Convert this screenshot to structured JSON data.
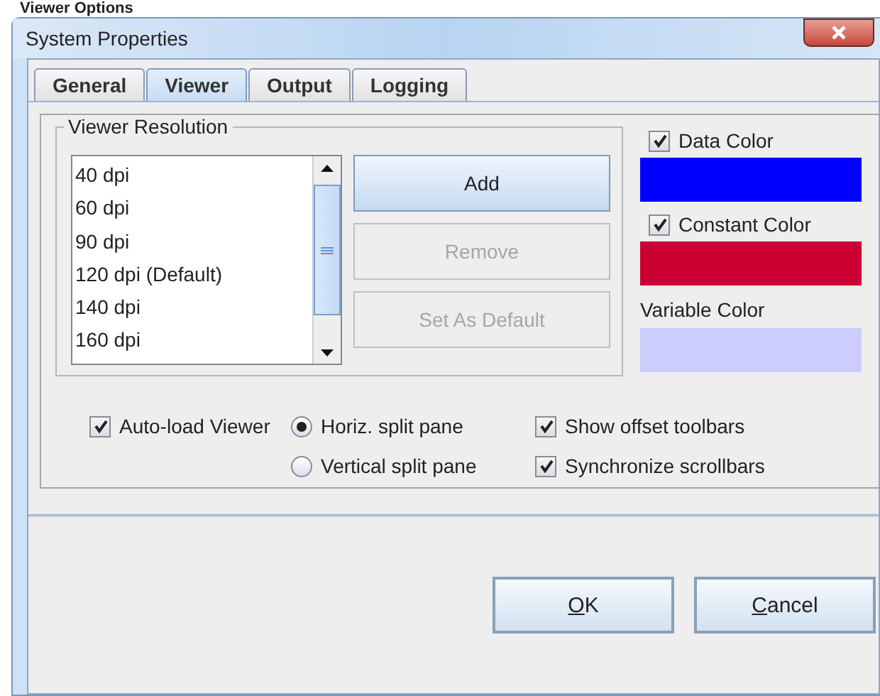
{
  "heading": "Viewer Options",
  "window": {
    "title": "System Properties"
  },
  "tabs": [
    {
      "label": "General",
      "selected": false
    },
    {
      "label": "Viewer",
      "selected": true
    },
    {
      "label": "Output",
      "selected": false
    },
    {
      "label": "Logging",
      "selected": false
    }
  ],
  "resolution": {
    "title": "Viewer Resolution",
    "items": [
      {
        "label": "40 dpi",
        "selected": false
      },
      {
        "label": "60 dpi",
        "selected": false
      },
      {
        "label": "90 dpi",
        "selected": false
      },
      {
        "label": "120 dpi (Default)",
        "selected": false
      },
      {
        "label": "140 dpi",
        "selected": false
      },
      {
        "label": "160 dpi",
        "selected": false
      }
    ],
    "buttons": [
      {
        "label": "Add",
        "disabled": false
      },
      {
        "label": "Remove",
        "disabled": true
      },
      {
        "label": "Set As Default",
        "disabled": true
      }
    ]
  },
  "colors": [
    {
      "kind": "checkbox",
      "label": "Data Color",
      "checked": true,
      "color": "#0000ff"
    },
    {
      "kind": "checkbox",
      "label": "Constant Color",
      "checked": true,
      "color": "#cc0033"
    },
    {
      "kind": "label",
      "label": "Variable Color",
      "color": "#ccccff"
    }
  ],
  "options": [
    {
      "kind": "checkbox",
      "label": "Auto-load Viewer",
      "checked": true
    },
    {
      "kind": "radio",
      "label": "Horiz. split pane",
      "checked": true
    },
    {
      "kind": "checkbox",
      "label": "Show offset toolbars",
      "checked": true
    },
    {
      "kind": "blank"
    },
    {
      "kind": "radio",
      "label": "Vertical split pane",
      "checked": false
    },
    {
      "kind": "checkbox",
      "label": "Synchronize scrollbars",
      "checked": true
    }
  ],
  "buttons": [
    {
      "label": "OK",
      "underline_first": true
    },
    {
      "label": "Cancel",
      "underline_first": true
    }
  ]
}
